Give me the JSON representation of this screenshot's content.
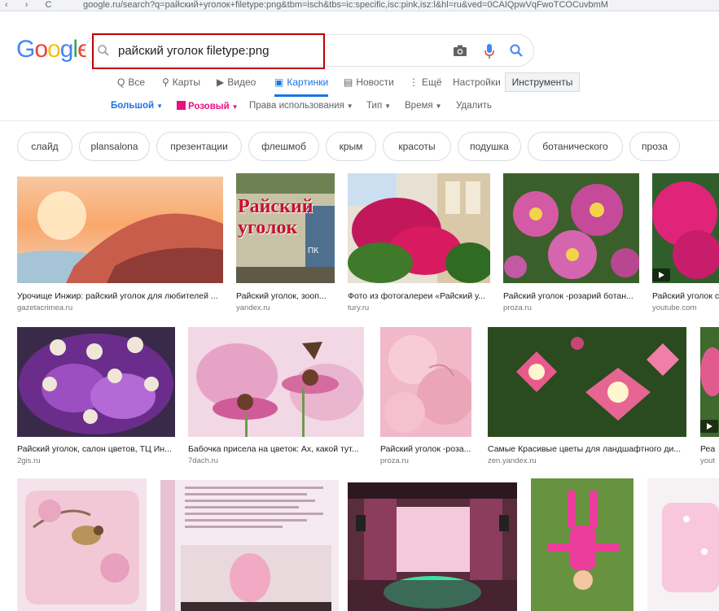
{
  "browser": {
    "nav_icons": "‹ › C",
    "url": "google.ru/search?q=райский+уголок+filetype:png&tbm=isch&tbs=ic:specific,isc:pink,isz:l&hl=ru&ved=0CAIQpwVqFwoTCOCuvbmM"
  },
  "logo": {
    "letters": [
      "G",
      "o",
      "o",
      "g",
      "l",
      "e"
    ]
  },
  "search": {
    "query": "райский уголок filetype:png"
  },
  "tabs": [
    {
      "label": "Все",
      "icon": "Q"
    },
    {
      "label": "Карты",
      "icon": "⚲"
    },
    {
      "label": "Видео",
      "icon": "▶"
    },
    {
      "label": "Картинки",
      "icon": "▣"
    },
    {
      "label": "Новости",
      "icon": "▤"
    },
    {
      "label": "Ещё",
      "icon": "⋮"
    },
    {
      "label": "Настройки",
      "icon": ""
    }
  ],
  "tools_label": "Инструменты",
  "filters": {
    "size": "Большой",
    "color": "Розовый",
    "rights": "Права использования",
    "type": "Тип",
    "time": "Время",
    "clear": "Удалить"
  },
  "chips": [
    "слайд",
    "plansalona",
    "презентации",
    "флешмоб",
    "крым",
    "красоты",
    "подушка",
    "ботанического",
    "проза"
  ],
  "results_row1": [
    {
      "title": "Урочище Инжир: райский уголок для любителей ...",
      "source": "gazetacrimea.ru"
    },
    {
      "title": "Райский уголок, зооп...",
      "source": "yandex.ru"
    },
    {
      "title": "Фото из фотогалереи «Райский у...",
      "source": "tury.ru"
    },
    {
      "title": "Райский уголок -розарий ботан...",
      "source": "proza.ru"
    },
    {
      "title": "Райский уголок с",
      "source": "youtube.com"
    }
  ],
  "results_row2": [
    {
      "title": "Райский уголок, салон цветов, ТЦ Ин...",
      "source": "2gis.ru"
    },
    {
      "title": "Бабочка присела на цветок: Ах, какой тут...",
      "source": "7dach.ru"
    },
    {
      "title": "Райский уголок -роза...",
      "source": "proza.ru"
    },
    {
      "title": "Самые Красивые цветы для ландшафтного ди...",
      "source": "zen.yandex.ru"
    },
    {
      "title": "Реа",
      "source": "yout"
    }
  ],
  "image_texts": {
    "sign": "Райский уголок",
    "sign_small": "ПК"
  },
  "colors": {
    "accent": "#1a73e8",
    "highlight_box": "#c00000",
    "pink_filter": "#e8107e"
  }
}
